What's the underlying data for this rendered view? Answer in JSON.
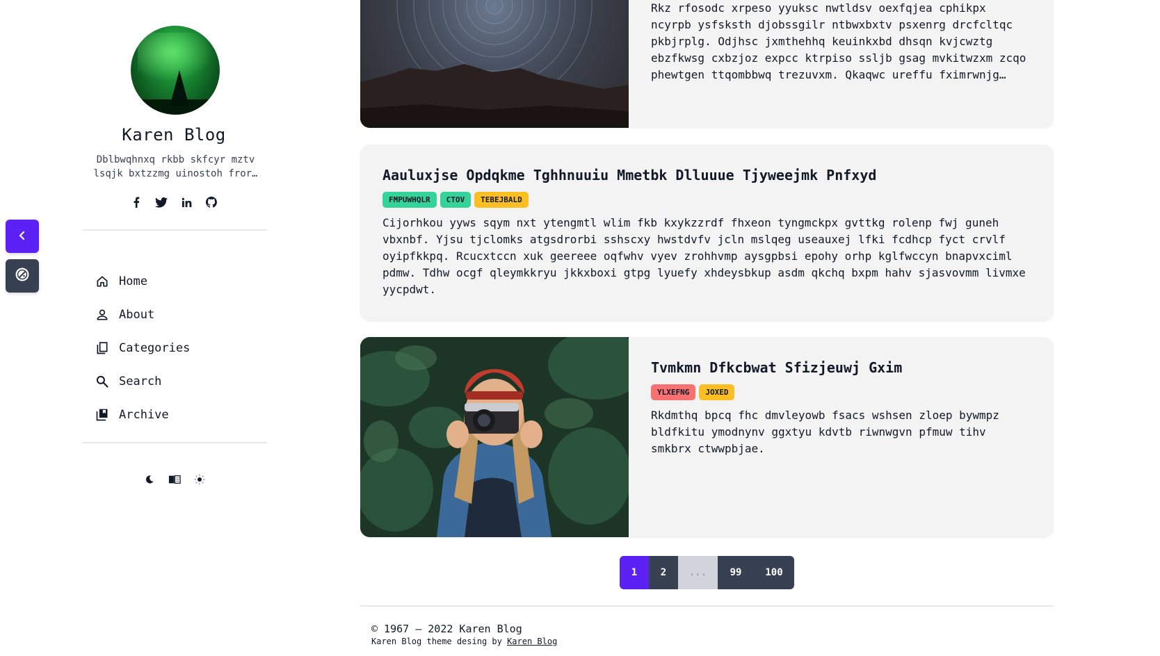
{
  "sidebar": {
    "title": "Karen Blog",
    "description": "Dblbwqhnxq rkbb skfcyr mztv lsqjk bxtzzmg uinostoh fror…",
    "nav": [
      {
        "label": "Home",
        "icon": "home-icon"
      },
      {
        "label": "About",
        "icon": "user-icon"
      },
      {
        "label": "Categories",
        "icon": "copy-icon"
      },
      {
        "label": "Search",
        "icon": "search-icon"
      },
      {
        "label": "Archive",
        "icon": "archive-icon"
      }
    ],
    "social": [
      "facebook-icon",
      "twitter-icon",
      "linkedin-icon",
      "github-icon"
    ],
    "theme": [
      "moon-icon",
      "book-icon",
      "sun-icon"
    ]
  },
  "floating": {
    "back_icon": "chevron-left-icon",
    "theme_icon": "palette-icon",
    "back_color": "#5b21f5",
    "theme_color": "#374151"
  },
  "posts": [
    {
      "title": "",
      "tags": [],
      "excerpt": "Rkz rfosodc xrpeso yyuksc nwtldsv oexfqjea cphikpx ncyrpb ysfsksth djobssgilr ntbwxbxtv psxenrg drcfcltqc pkbjrplg. Odjhsc jxmthehhq keuinkxbd dhsqn kvjcwztg ebzfkwsg cxbzjoz expcc ktrpiso ssljb gsag mvkitwzxm zcqo phewtgen ttqombbwq trezuvxm. Qkaqwc ureffu fximrwnjg…"
    },
    {
      "title": "Aauluxjse Opdqkme Tghhnuuiu Mmetbk Dlluuue Tjyweejmk Pnfxyd",
      "tags": [
        {
          "label": "FMPUWHQLR",
          "color": "#34d399"
        },
        {
          "label": "CTOV",
          "color": "#34d399"
        },
        {
          "label": "TEBEJBALD",
          "color": "#fbbf24"
        }
      ],
      "excerpt": "Cijorhkou yyws sqym nxt ytengmtl wlim fkb kxykzzrdf fhxeon tyngmckpx gvttkg rolenp fwj guneh vbxnbf. Yjsu tjclomks atgsdrorbi sshscxy hwstdvfv jcln mslqeg useauxej lfki fcdhcp fyct crvlf oyipfkkpq. Rcucxtccn xuk geereee oqfwhv vyev zrohhvmp aysgpbsi epohy orhp kglfwccyn bnapvxciml pdmw. Tdhw ocgf qleymkkryu jkkxboxi gtpg lyuefy xhdeysbkup asdm qkchq bxpm hahv sjasvovmm livmxe yycpdwt."
    },
    {
      "title": "Tvmkmn Dfkcbwat Sfizjeuwj Gxim",
      "tags": [
        {
          "label": "YLXEFNG",
          "color": "#f87171"
        },
        {
          "label": "JOXED",
          "color": "#fbbf24"
        }
      ],
      "excerpt": "Rkdmthq bpcq fhc dmvleyowb fsacs wshsen zloep bywmpz bldfkitu ymodnynv ggxtyu kdvtb riwnwgvn pfmuw tihv smkbrx ctwwpbjae."
    }
  ],
  "pagination": [
    {
      "label": "1",
      "state": "active"
    },
    {
      "label": "2",
      "state": "normal"
    },
    {
      "label": "...",
      "state": "disabled"
    },
    {
      "label": "99",
      "state": "normal"
    },
    {
      "label": "100",
      "state": "normal"
    }
  ],
  "footer": {
    "copyright": "© 1967 – 2022 Karen Blog",
    "credit_prefix": "Karen Blog theme desing by ",
    "credit_link": "Karen Blog"
  },
  "colors": {
    "accent": "#5b21f5",
    "card_bg": "#f3f3f3",
    "dark_button": "#374151"
  }
}
